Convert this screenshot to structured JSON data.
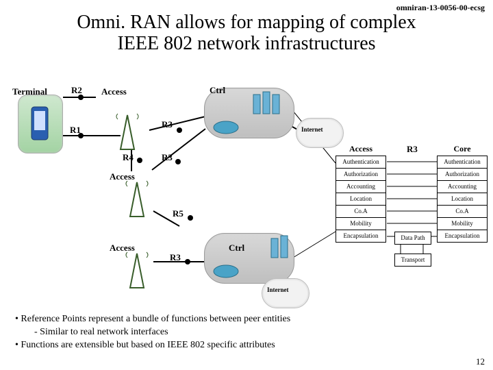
{
  "doc_id": "omniran-13-0056-00-ecsg",
  "title_line1": "Omni. RAN allows for mapping of complex",
  "title_line2": "IEEE 802 network infrastructures",
  "slide_no": "12",
  "bullets": {
    "b1": "• Reference Points represent a bundle of functions between peer entities",
    "b1a": "- Similar to real network interfaces",
    "b2": "• Functions are extensible but based on IEEE 802 specific attributes"
  },
  "labels": {
    "terminal": "Terminal",
    "access": "Access",
    "ctrl": "Ctrl",
    "core": "Core",
    "internet": "Internet",
    "r1": "R1",
    "r2": "R2",
    "r3": "R3",
    "r4": "R4",
    "r5": "R5"
  },
  "funcs": {
    "auth": "Authentication",
    "authz": "Authorization",
    "acct": "Accounting",
    "loc": "Location",
    "coa": "Co.A",
    "mob": "Mobility",
    "enc": "Encapsulation",
    "dpath": "Data Path",
    "trans": "Transport"
  }
}
